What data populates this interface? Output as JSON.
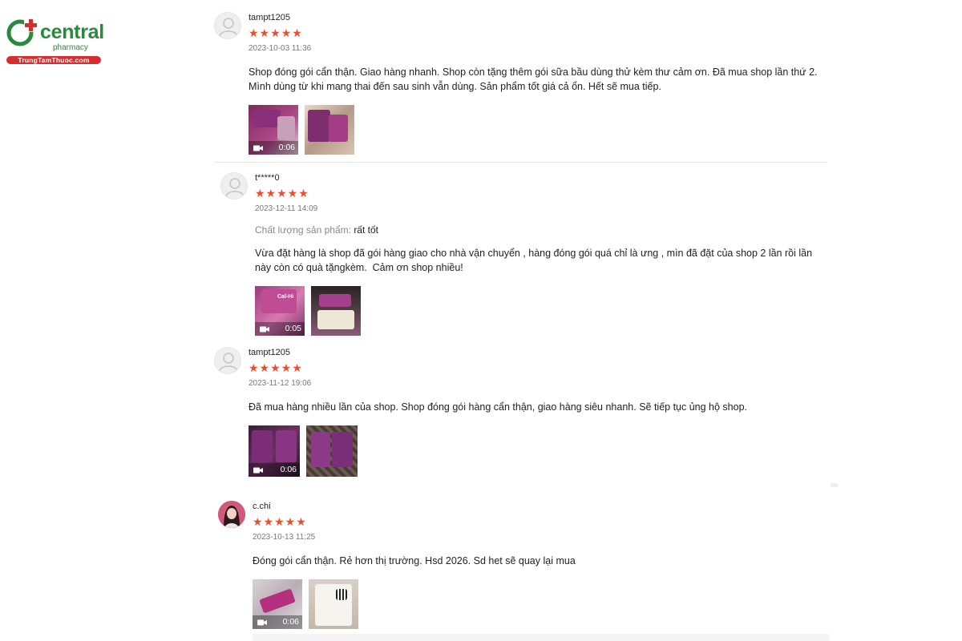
{
  "brand": {
    "name": "central",
    "tagline": "pharmacy",
    "site": "TrungTamThuoc.com"
  },
  "colors": {
    "star": "#ee4d2d",
    "brand_green": "#2a8a3c",
    "brand_red": "#d62e2e"
  },
  "reviews": [
    {
      "username": "tampt1205",
      "stars": "★★★★★",
      "rating": 5,
      "date": "2023-10-03 11:36",
      "comment": "Shop đóng gói cẩn thận. Giao hàng nhanh. Shop còn tặng thêm gói sữa bầu dùng thử kèm thư cảm ơn. Đã mua shop lần thứ 2.\nMình dùng từ khi mang thai đến sau sinh vẫn dùng. Sản phẩm tốt giá cả ổn. Hết sẽ mua tiếp.",
      "video_duration": "0:06"
    },
    {
      "username": "t*****0",
      "stars": "★★★★★",
      "rating": 5,
      "date": "2023-12-11 14:09",
      "attribute_label": "Chất lượng sản phẩm:",
      "attribute_value": "rất tốt",
      "comment": "Vừa đặt hàng là shop đã gói hàng giao cho nhà vận chuyển , hàng đóng gói quá chỉ là ưng , mìn đã đặt của shop 2 lần rồi lần này còn có quà tặngkèm.  Cảm ơn shop nhiều!",
      "video_duration": "0:05"
    },
    {
      "username": "tampt1205",
      "stars": "★★★★★",
      "rating": 5,
      "date": "2023-11-12 19:06",
      "comment": "Đã mua hàng nhiều lần của shop. Shop đóng gói hàng cẩn thận, giao hàng siêu nhanh. Sẽ tiếp tục ủng hộ shop.",
      "video_duration": "0:06"
    },
    {
      "username": "c.chi",
      "stars": "★★★★★",
      "rating": 5,
      "date": "2023-10-13 11:25",
      "comment": "Đóng gói cẩn thận. Rẻ hơn thị trường. Hsd 2026. Sd het sẽ quay lại mua",
      "video_duration": "0:06"
    }
  ]
}
